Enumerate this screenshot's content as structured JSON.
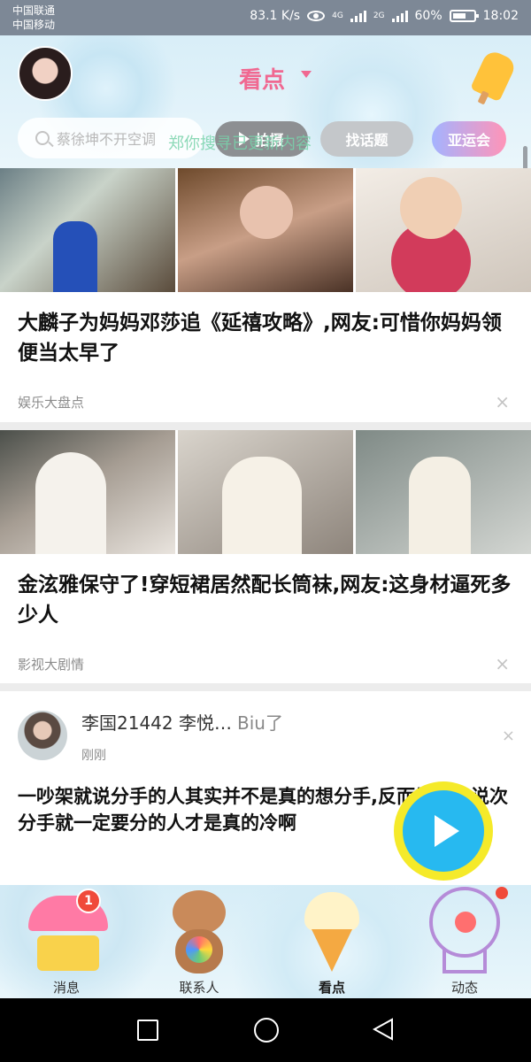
{
  "status_bar": {
    "carrier1": "中国联通",
    "carrier2": "中国移动",
    "speed": "83.1 K/s",
    "net1": "4G",
    "net2": "2G",
    "battery": "60%",
    "time": "18:02"
  },
  "header": {
    "title": "看点",
    "search_placeholder": "蔡徐坤不开空调",
    "overlay_text": "郑你搜寻已更新内容",
    "pills": {
      "shoot": "拍摄",
      "topic": "找话题",
      "games": "亚运会"
    }
  },
  "feed": [
    {
      "headline": "大麟子为妈妈邓莎追《延禧攻略》,网友:可惜你妈妈领便当太早了",
      "source": "娱乐大盘点",
      "close": "×"
    },
    {
      "headline": "金泫雅保守了!穿短裙居然配长筒袜,网友:这身材逼死多少人",
      "source": "影视大剧情",
      "close": "×"
    }
  ],
  "post": {
    "user": "李国21442 李悦…",
    "action": "Biu了",
    "time": "刚刚",
    "text": "一吵架就说分手的人其实并不是真的想分手,反而是那些说次分手就一定要分的人才是真的冷啊",
    "close": "×"
  },
  "bottom_nav": {
    "messages": "消息",
    "messages_badge": "1",
    "contacts": "联系人",
    "kandian": "看点",
    "feeds": "动态"
  }
}
